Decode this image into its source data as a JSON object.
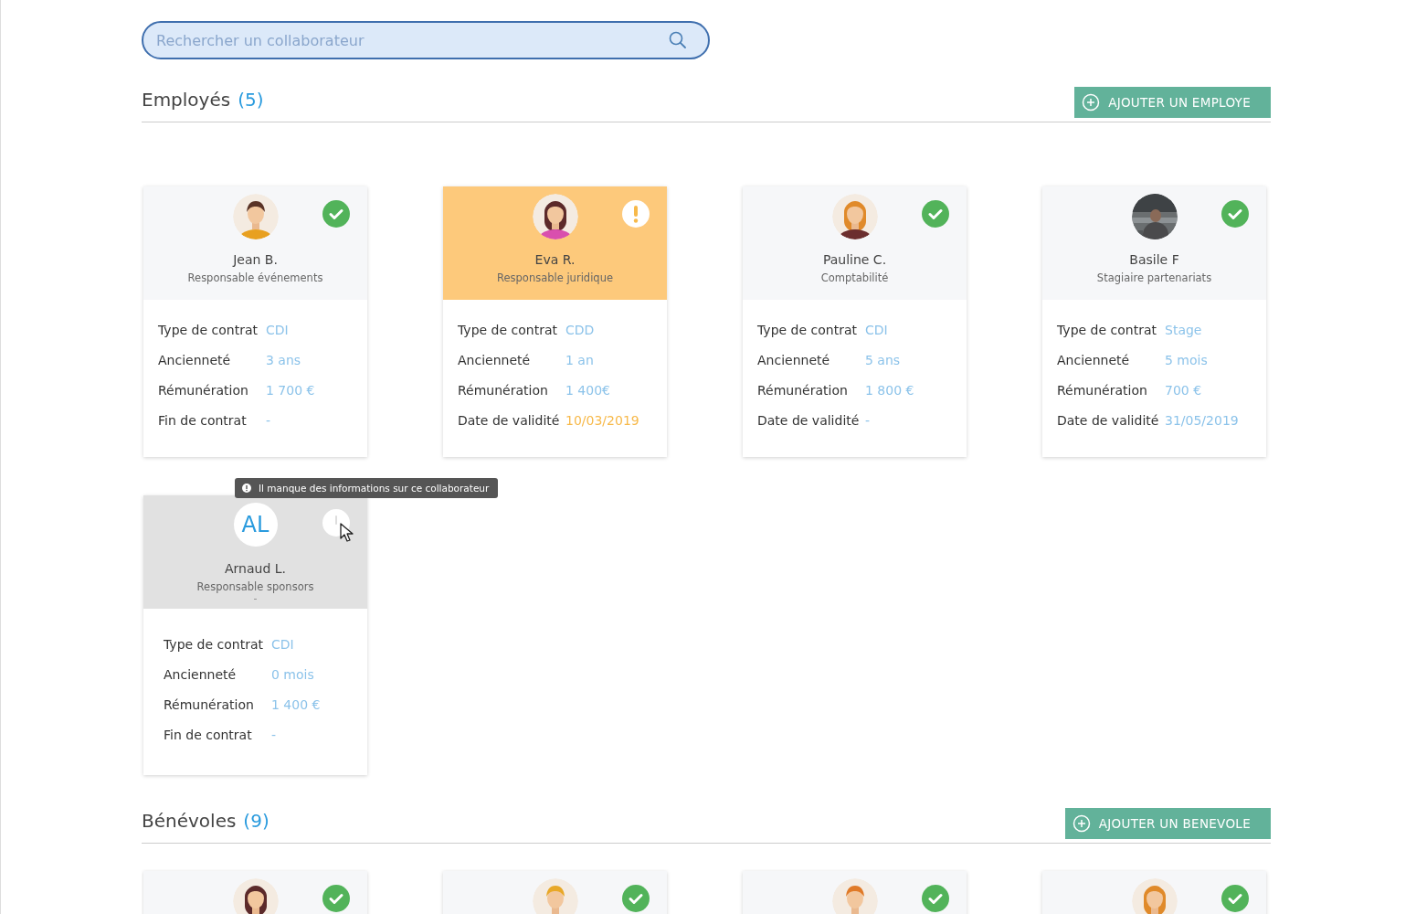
{
  "search": {
    "placeholder": "Rechercher un collaborateur"
  },
  "sections": [
    {
      "title": "Employés",
      "count": "(5)",
      "add_button": "AJOUTER UN EMPLOYE",
      "cards": [
        {
          "name": "Jean B.",
          "role": "Responsable événements",
          "kind": "ok",
          "avatar": {
            "kind": "figure"
          },
          "fields": [
            {
              "label": "Type de contrat",
              "value": "CDI",
              "highlighted": false
            },
            {
              "label": "Ancienneté",
              "value": "3 ans",
              "highlighted": false
            },
            {
              "label": "Rémunération",
              "value": "1 700 €",
              "highlighted": false
            },
            {
              "label": "Fin de contrat",
              "value": "-",
              "highlighted": false
            }
          ]
        },
        {
          "name": "Eva R.",
          "role": "Responsable juridique",
          "kind": "warning",
          "avatar": {
            "kind": "figure"
          },
          "fields": [
            {
              "label": "Type de contrat",
              "value": "CDD",
              "highlighted": false
            },
            {
              "label": "Ancienneté",
              "value": "1 an",
              "highlighted": false
            },
            {
              "label": "Rémunération",
              "value": "1 400€",
              "highlighted": false
            },
            {
              "label": "Date de validité",
              "value": "10/03/2019",
              "highlighted": true
            }
          ]
        },
        {
          "name": "Pauline C.",
          "role": "Comptabilité",
          "kind": "ok",
          "avatar": {
            "kind": "figure"
          },
          "fields": [
            {
              "label": "Type de contrat",
              "value": "CDI",
              "highlighted": false
            },
            {
              "label": "Ancienneté",
              "value": "5 ans",
              "highlighted": false
            },
            {
              "label": "Rémunération",
              "value": "1 800 €",
              "highlighted": false
            },
            {
              "label": "Date de validité",
              "value": "-",
              "highlighted": false
            }
          ]
        },
        {
          "name": "Basile F",
          "role": "Stagiaire partenariats",
          "kind": "ok",
          "avatar": {
            "kind": "picture"
          },
          "fields": [
            {
              "label": "Type de contrat",
              "value": "Stage",
              "highlighted": false
            },
            {
              "label": "Ancienneté",
              "value": "5 mois",
              "highlighted": false
            },
            {
              "label": "Rémunération",
              "value": "700 €",
              "highlighted": false
            },
            {
              "label": "Date de validité",
              "value": "31/05/2019",
              "highlighted": false
            }
          ]
        },
        {
          "name": "Arnaud L.",
          "role": "Responsable sponsors",
          "extra": "-",
          "kind": "incomplete",
          "hovered": true,
          "tooltip": "Il manque des informations sur ce collaborateur",
          "avatar": {
            "kind": "initials",
            "text": "AL"
          },
          "fields": [
            {
              "label": "Type de contrat",
              "value": "CDI",
              "highlighted": false
            },
            {
              "label": "Ancienneté",
              "value": "0 mois",
              "highlighted": false
            },
            {
              "label": "Rémunération",
              "value": "1 400 €",
              "highlighted": false
            },
            {
              "label": "Fin de contrat",
              "value": "-",
              "highlighted": false
            }
          ]
        }
      ]
    },
    {
      "title": "Bénévoles",
      "count": "(9)",
      "add_button": "AJOUTER UN BENEVOLE",
      "cards": [
        {
          "kind": "ok",
          "avatar": {
            "kind": "figure"
          }
        },
        {
          "kind": "ok",
          "avatar": {
            "kind": "figure"
          }
        },
        {
          "kind": "ok",
          "avatar": {
            "kind": "figure"
          }
        },
        {
          "kind": "ok",
          "avatar": {
            "kind": "figure"
          }
        }
      ]
    }
  ]
}
